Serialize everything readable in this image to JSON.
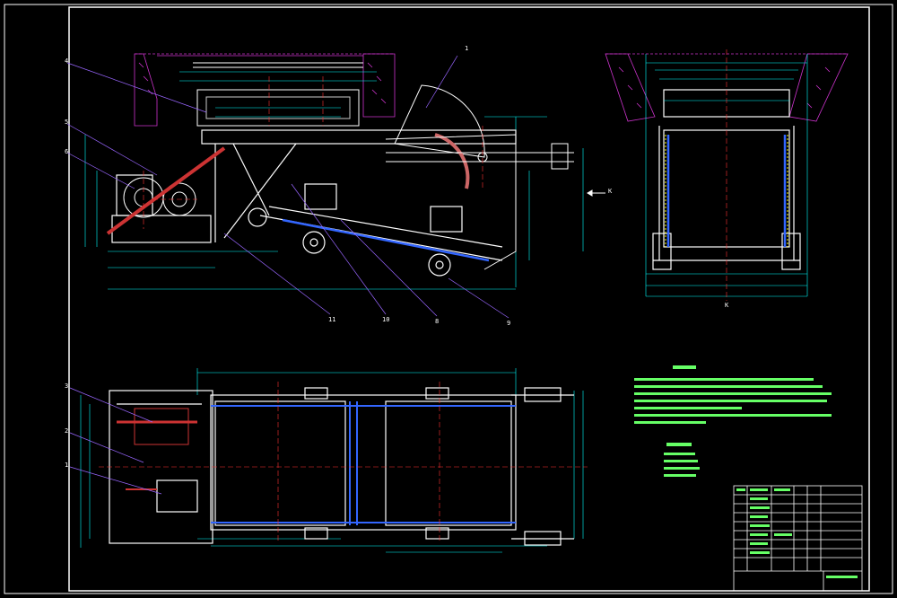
{
  "drawing": {
    "view_markers": {
      "side_view_arrow": "K",
      "end_view_label": "K"
    },
    "side_view_part_numbers": [
      "1",
      "4",
      "5",
      "6",
      "11",
      "10",
      "8",
      "9"
    ],
    "plan_view_part_numbers": [
      "3",
      "2",
      "1"
    ],
    "colors": {
      "background": "#000000",
      "frame": "#ffffff",
      "outline": "#ffffff",
      "centerline": "#ff3333",
      "dimension": "#00ffff",
      "ground": "#cc33cc",
      "belt": "#3366ff",
      "leader": "#9966ff",
      "notes": "#66ff66",
      "hidden": "#ffff00"
    }
  }
}
